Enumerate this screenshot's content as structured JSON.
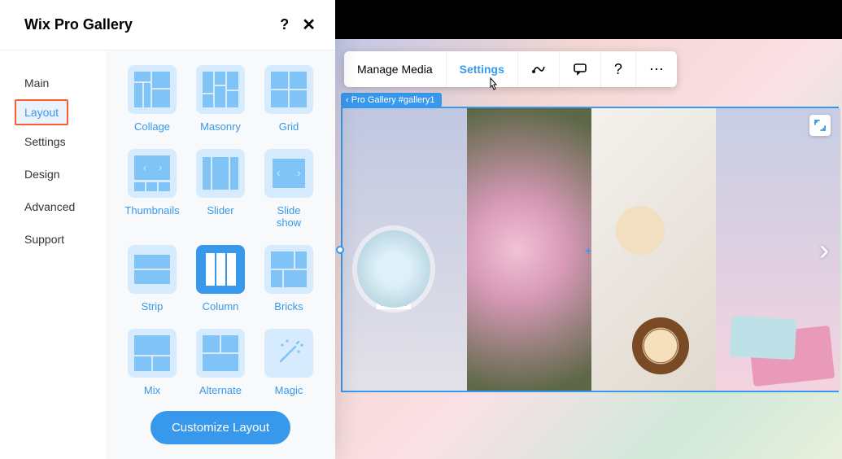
{
  "panel": {
    "title": "Wix Pro Gallery",
    "help_symbol": "?",
    "close_symbol": "✕"
  },
  "nav": {
    "items": [
      {
        "label": "Main"
      },
      {
        "label": "Layout",
        "active": true
      },
      {
        "label": "Settings"
      },
      {
        "label": "Design"
      },
      {
        "label": "Advanced"
      },
      {
        "label": "Support"
      }
    ]
  },
  "layouts": {
    "items": [
      {
        "label": "Collage",
        "kind": "collage"
      },
      {
        "label": "Masonry",
        "kind": "masonry"
      },
      {
        "label": "Grid",
        "kind": "grid"
      },
      {
        "label": "Thumbnails",
        "kind": "thumbnails"
      },
      {
        "label": "Slider",
        "kind": "slider"
      },
      {
        "label": "Slide show",
        "kind": "slideshow"
      },
      {
        "label": "Strip",
        "kind": "strip"
      },
      {
        "label": "Column",
        "kind": "column",
        "selected": true
      },
      {
        "label": "Bricks",
        "kind": "bricks"
      },
      {
        "label": "Mix",
        "kind": "mix"
      },
      {
        "label": "Alternate",
        "kind": "alternate"
      },
      {
        "label": "Magic",
        "kind": "magic"
      }
    ],
    "customize_label": "Customize Layout"
  },
  "toolbar": {
    "manage_media_label": "Manage Media",
    "settings_label": "Settings",
    "help_symbol": "?",
    "more_symbol": "⋯"
  },
  "selection": {
    "tag_label": "Pro Gallery #gallery1",
    "back_symbol": "‹"
  },
  "gallery": {
    "slides": [
      {
        "discount_label": "75% off"
      },
      {},
      {},
      {}
    ],
    "next_symbol": "›",
    "plus_symbol": "+"
  }
}
